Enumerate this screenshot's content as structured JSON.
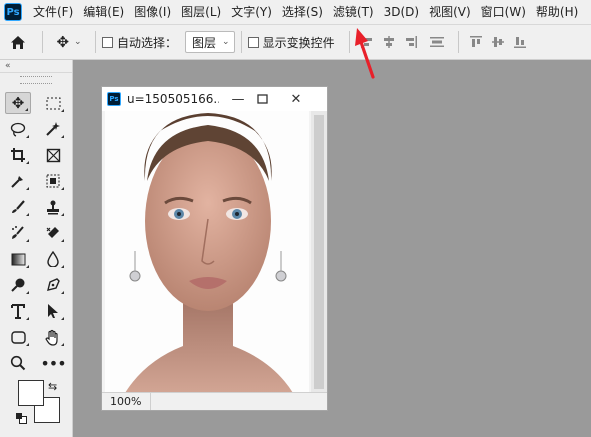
{
  "app": {
    "logo": "Ps"
  },
  "menu": [
    "文件(F)",
    "编辑(E)",
    "图像(I)",
    "图层(L)",
    "文字(Y)",
    "选择(S)",
    "滤镜(T)",
    "3D(D)",
    "视图(V)",
    "窗口(W)",
    "帮助(H)"
  ],
  "options": {
    "auto_select_label": "自动选择：",
    "auto_select_checked": false,
    "layer_select": "图层",
    "show_transform_label": "显示变换控件",
    "show_transform_checked": false
  },
  "toolbox": {
    "collapse": "«"
  },
  "document": {
    "icon": "Ps",
    "title": "u=150505166...",
    "zoom": "100%"
  },
  "annotation": {
    "arrow_color": "#e8202a",
    "points_to": "滤镜(T)"
  },
  "colors": {
    "accent": "#31a8ff",
    "canvas_bg": "#9a9a9a"
  }
}
